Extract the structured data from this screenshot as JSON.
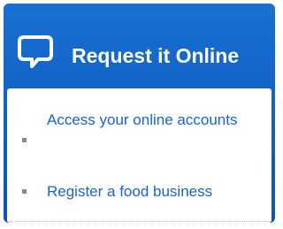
{
  "widget": {
    "title": "Request it Online",
    "icon": "speech-bubble-icon",
    "links": [
      {
        "label": "Access your online accounts"
      },
      {
        "label": "Register a food business"
      }
    ]
  },
  "colors": {
    "header_blue": "#1061c2",
    "link_blue": "#1b63c6",
    "bullet_gray": "#8a8a8a"
  }
}
